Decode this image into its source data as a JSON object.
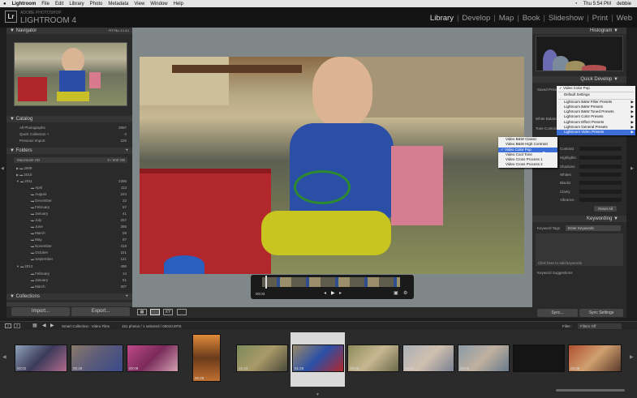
{
  "menubar": {
    "apple": "",
    "items": [
      "Lightroom",
      "File",
      "Edit",
      "Library",
      "Photo",
      "Metadata",
      "View",
      "Window",
      "Help"
    ],
    "clock": "Thu 5:54 PM",
    "user": "debbie"
  },
  "identity": {
    "logo": "Lr",
    "camera": "ADOBE PHOTOSHOP",
    "title": "LIGHTROOM 4"
  },
  "modules": [
    "Library",
    "Develop",
    "Map",
    "Book",
    "Slideshow",
    "Print",
    "Web"
  ],
  "navigator": {
    "title": "Navigator",
    "zoom": "FIT  FILL  1:1  4:1"
  },
  "catalog": {
    "title": "Catalog",
    "items": [
      {
        "label": "All Photographs",
        "count": "3997"
      },
      {
        "label": "Quick Collection +",
        "count": "0"
      },
      {
        "label": "Previous Import",
        "count": "225"
      }
    ]
  },
  "folders": {
    "title": "Folders",
    "volume": "Macintosh HD",
    "volume_info": "0 / 500 GB",
    "years": [
      {
        "label": "2009",
        "count": ""
      },
      {
        "label": "2010",
        "count": ""
      },
      {
        "label": "2011",
        "count": "2396"
      }
    ],
    "months2011": [
      {
        "label": "April",
        "count": "113"
      },
      {
        "label": "August",
        "count": "244"
      },
      {
        "label": "December",
        "count": "22"
      },
      {
        "label": "February",
        "count": "57"
      },
      {
        "label": "January",
        "count": "41"
      },
      {
        "label": "July",
        "count": "257"
      },
      {
        "label": "June",
        "count": "385"
      },
      {
        "label": "March",
        "count": "58"
      },
      {
        "label": "May",
        "count": "87"
      },
      {
        "label": "November",
        "count": "418"
      },
      {
        "label": "October",
        "count": "221"
      },
      {
        "label": "September",
        "count": "121"
      }
    ],
    "year2012": {
      "label": "2012",
      "count": "496"
    },
    "months2012": [
      {
        "label": "February",
        "count": "14"
      },
      {
        "label": "January",
        "count": "51"
      },
      {
        "label": "March",
        "count": "307"
      }
    ]
  },
  "collections": {
    "title": "Collections"
  },
  "left_buttons": {
    "import": "Import...",
    "export": "Export..."
  },
  "video": {
    "time_start": "00:03",
    "time_end": "00:10 MTS"
  },
  "right": {
    "histogram": "Histogram",
    "quick_develop": "Quick Develop",
    "saved_preset": "Saved Preset",
    "white_balance": "White Balance",
    "tone_control": "Tone Control",
    "controls": [
      "Contrast",
      "Highlights",
      "Shadows",
      "Whites",
      "Blacks",
      "Clarity",
      "Vibrance"
    ],
    "reset_all": "Reset All",
    "keywording": "Keywording",
    "keyword_tags": "Keyword Tags",
    "enter_keywords": "Enter Keywords",
    "click_add": "Click here to add keywords",
    "keyword_suggestions": "Keyword Suggestions",
    "sync": "Sync...",
    "sync_settings": "Sync Settings"
  },
  "preset_menu": {
    "items": [
      {
        "label": "Video Color Pop",
        "checked": true,
        "arrow": false
      },
      {
        "label": "Default Settings",
        "checked": false,
        "arrow": false
      },
      {
        "label": "Lightroom B&W Filter Presets",
        "checked": false,
        "arrow": true
      },
      {
        "label": "Lightroom B&W Presets",
        "checked": false,
        "arrow": true
      },
      {
        "label": "Lightroom B&W Toned Presets",
        "checked": false,
        "arrow": true
      },
      {
        "label": "Lightroom Color Presets",
        "checked": false,
        "arrow": true
      },
      {
        "label": "Lightroom Effect Presets",
        "checked": false,
        "arrow": true
      },
      {
        "label": "Lightroom General Presets",
        "checked": false,
        "arrow": true
      },
      {
        "label": "Lightroom Video Presets",
        "checked": false,
        "arrow": true
      }
    ]
  },
  "video_submenu": {
    "items": [
      {
        "label": "Video B&W Classic",
        "checked": false
      },
      {
        "label": "Video B&W High Contrast",
        "checked": false
      },
      {
        "label": "Video Color Pop",
        "checked": true
      },
      {
        "label": "Video Cool Tone",
        "checked": false
      },
      {
        "label": "Video Cross Process 1",
        "checked": false
      },
      {
        "label": "Video Cross Process 2",
        "checked": false
      }
    ]
  },
  "filmstrip": {
    "path": "Smart Collection : Video Files",
    "status": "151 photos / 1 selected / 00010.MTS",
    "filter": "Filter :",
    "filter_value": "Filters Off",
    "durations": [
      "00:02",
      "00:28",
      "00:09",
      "00:28",
      "01:43",
      "01:26",
      "00:20",
      "00:02",
      "00:18",
      "",
      "00:28"
    ]
  },
  "colors": {
    "accent": "#3d6fd8",
    "panel": "#2a2a2a",
    "bg": "#1e1e1e"
  }
}
